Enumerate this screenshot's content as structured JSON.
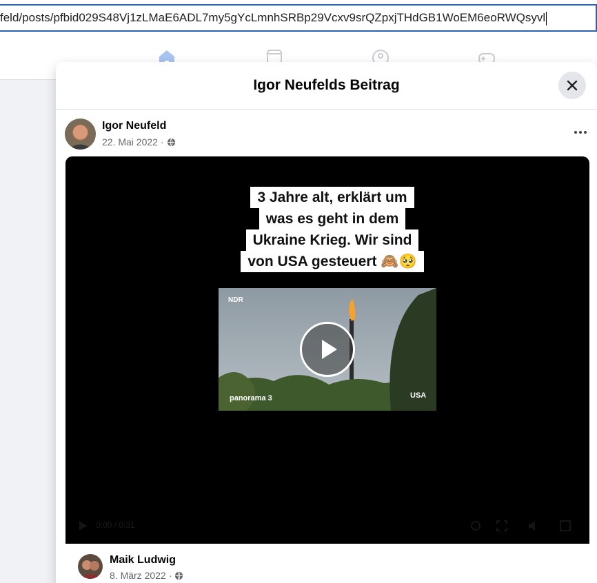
{
  "browser": {
    "url": "feld/posts/pfbid029S48Vj1zLMaE6ADL7my5gYcLmnhSRBp29Vcxv9srQZpxjTHdGB1WoEM6eoRWQsyvl"
  },
  "nav": {
    "icons": [
      "home-icon",
      "marketplace-icon",
      "groups-icon",
      "gaming-icon"
    ]
  },
  "dialog": {
    "title": "Igor Neufelds Beitrag"
  },
  "post": {
    "author": "Igor Neufeld",
    "date": "22. Mai 2022",
    "separator": "·",
    "video": {
      "caption_lines": [
        "3 Jahre alt, erklärt um",
        "was es geht in dem",
        "Ukraine Krieg. Wir sind",
        "von USA gesteuert 🙈🥺"
      ],
      "thumb_tag_top": "NDR",
      "thumb_logo": "panorama 3",
      "thumb_tag_bottom": "USA",
      "time_display": "0:00 / 0:31"
    }
  },
  "comment": {
    "author": "Maik Ludwig",
    "date": "8. März 2022",
    "separator": "·"
  },
  "colors": {
    "accent": "#2b62b5",
    "text_secondary": "#65676b",
    "close_bg": "#e4e6eb"
  }
}
